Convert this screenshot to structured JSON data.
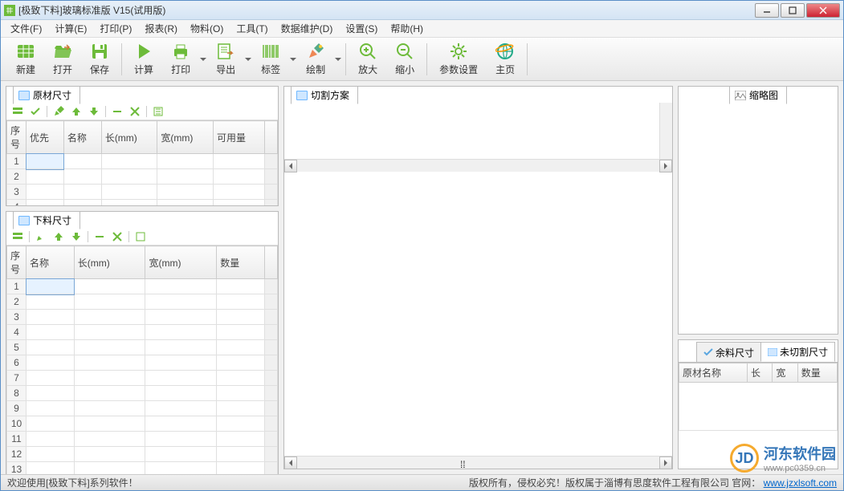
{
  "title": "[极致下料]玻璃标准版 V15(试用版)",
  "menu": [
    "文件(F)",
    "计算(E)",
    "打印(P)",
    "报表(R)",
    "物料(O)",
    "工具(T)",
    "数据维护(D)",
    "设置(S)",
    "帮助(H)"
  ],
  "toolbar": [
    {
      "id": "new",
      "label": "新建",
      "icon": "table-new",
      "color": "#6dbb3a"
    },
    {
      "id": "open",
      "label": "打开",
      "icon": "folder-open",
      "color": "#6dbb3a"
    },
    {
      "id": "save",
      "label": "保存",
      "icon": "save",
      "color": "#6dbb3a"
    },
    {
      "sep": true
    },
    {
      "id": "calc",
      "label": "计算",
      "icon": "play",
      "color": "#6dbb3a"
    },
    {
      "id": "print",
      "label": "打印",
      "icon": "printer",
      "color": "#6dbb3a",
      "dd": true
    },
    {
      "id": "export",
      "label": "导出",
      "icon": "export",
      "color": "#6dbb3a",
      "dd": true
    },
    {
      "id": "label",
      "label": "标签",
      "icon": "barcode",
      "color": "#6dbb3a",
      "dd": true
    },
    {
      "id": "draw",
      "label": "绘制",
      "icon": "brush",
      "color": "#e85",
      "dd": true
    },
    {
      "sep": true
    },
    {
      "id": "zoomin",
      "label": "放大",
      "icon": "zoom-in",
      "color": "#6dbb3a"
    },
    {
      "id": "zoomout",
      "label": "缩小",
      "icon": "zoom-out",
      "color": "#6dbb3a"
    },
    {
      "sep": true
    },
    {
      "id": "params",
      "label": "参数设置",
      "icon": "gear",
      "color": "#6dbb3a"
    },
    {
      "id": "home",
      "label": "主页",
      "icon": "ie",
      "color": "#2a8"
    },
    {
      "sep": true
    }
  ],
  "panels": {
    "raw": {
      "title": "原材尺寸",
      "columns": [
        "序号",
        "优先",
        "名称",
        "长(mm)",
        "宽(mm)",
        "可用量"
      ],
      "rows": 4
    },
    "cutsize": {
      "title": "下料尺寸",
      "columns": [
        "序号",
        "名称",
        "长(mm)",
        "宽(mm)",
        "数量"
      ],
      "rows": 13
    },
    "cutplan": {
      "title": "切割方案"
    },
    "thumb": {
      "title": "缩略图"
    },
    "remain": {
      "tab1": "余料尺寸",
      "tab2": "未切割尺寸",
      "columns": [
        "原材名称",
        "长",
        "宽",
        "数量"
      ]
    }
  },
  "status": {
    "left": "欢迎使用[极致下料]系列软件！",
    "right_prefix": "版权所有，侵权必究！版权属于淄博有思度软件工程有限公司    官网：",
    "url": "www.jzxlsoft.com"
  },
  "watermark": {
    "text": "河东软件园",
    "url": "www.pc0359.cn"
  }
}
